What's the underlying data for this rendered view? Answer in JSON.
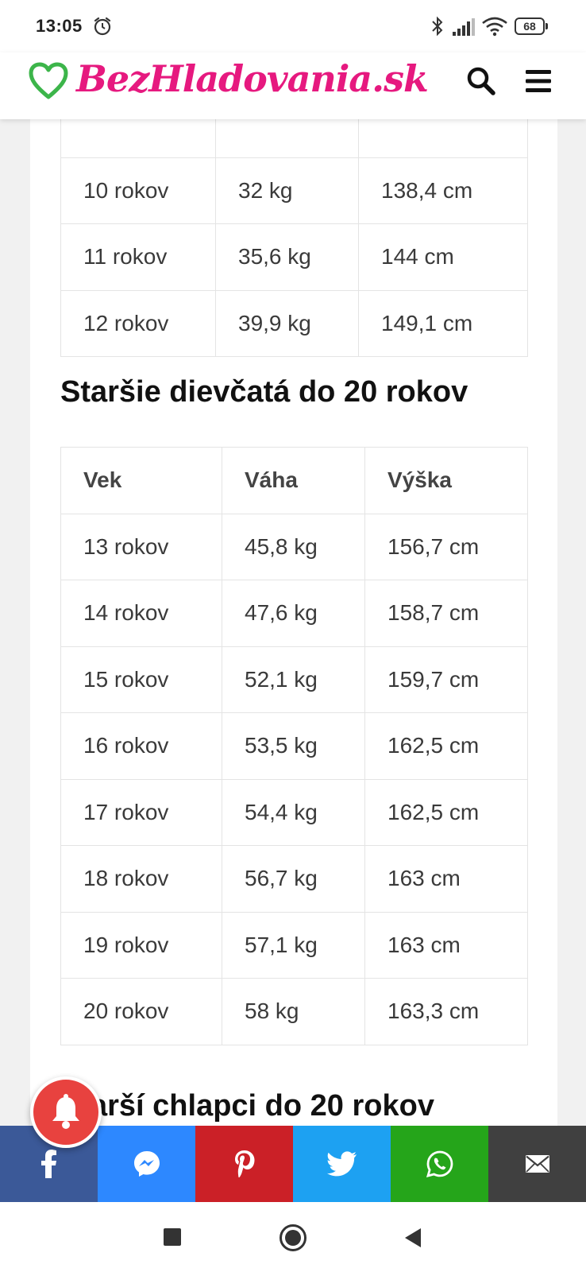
{
  "status_bar": {
    "time": "13:05",
    "battery": "68",
    "icons": [
      "alarm-icon",
      "bluetooth-icon",
      "signal-icon",
      "wifi-icon",
      "battery-icon"
    ]
  },
  "header": {
    "logo_text": "BezHladovania.sk",
    "logo_icon": "heart-icon",
    "brand_color": "#e6197f",
    "heart_color": "#3cb54a",
    "actions": [
      "search-icon",
      "menu-icon"
    ]
  },
  "table_top": {
    "rows": [
      [
        "",
        "",
        ""
      ],
      [
        "10 rokov",
        "32 kg",
        "138,4 cm"
      ],
      [
        "11 rokov",
        "35,6 kg",
        "144 cm"
      ],
      [
        "12 rokov",
        "39,9 kg",
        "149,1 cm"
      ]
    ]
  },
  "section_girls": {
    "heading": "Staršie dievčatá do 20 rokov",
    "columns": [
      "Vek",
      "Váha",
      "Výška"
    ],
    "rows": [
      [
        "13 rokov",
        "45,8 kg",
        "156,7 cm"
      ],
      [
        "14 rokov",
        "47,6 kg",
        "158,7 cm"
      ],
      [
        "15 rokov",
        "52,1 kg",
        "159,7 cm"
      ],
      [
        "16 rokov",
        "53,5 kg",
        "162,5 cm"
      ],
      [
        "17 rokov",
        "54,4 kg",
        "162,5 cm"
      ],
      [
        "18 rokov",
        "56,7 kg",
        "163 cm"
      ],
      [
        "19 rokov",
        "57,1 kg",
        "163 cm"
      ],
      [
        "20 rokov",
        "58 kg",
        "163,3 cm"
      ]
    ]
  },
  "section_boys": {
    "heading": "Starší chlapci do 20 rokov"
  },
  "notification_bell": {
    "icon": "bell-icon",
    "color": "#e8423f"
  },
  "share_bar": [
    {
      "name": "facebook",
      "icon": "facebook-icon",
      "color": "#3b5998"
    },
    {
      "name": "messenger",
      "icon": "messenger-icon",
      "color": "#2d88ff"
    },
    {
      "name": "pinterest",
      "icon": "pinterest-icon",
      "color": "#cb2027"
    },
    {
      "name": "twitter",
      "icon": "twitter-icon",
      "color": "#1da1f2"
    },
    {
      "name": "whatsapp",
      "icon": "whatsapp-icon",
      "color": "#25a51a"
    },
    {
      "name": "email",
      "icon": "email-icon",
      "color": "#404040"
    }
  ],
  "nav_bar": [
    "recents-icon",
    "home-icon",
    "back-icon"
  ]
}
